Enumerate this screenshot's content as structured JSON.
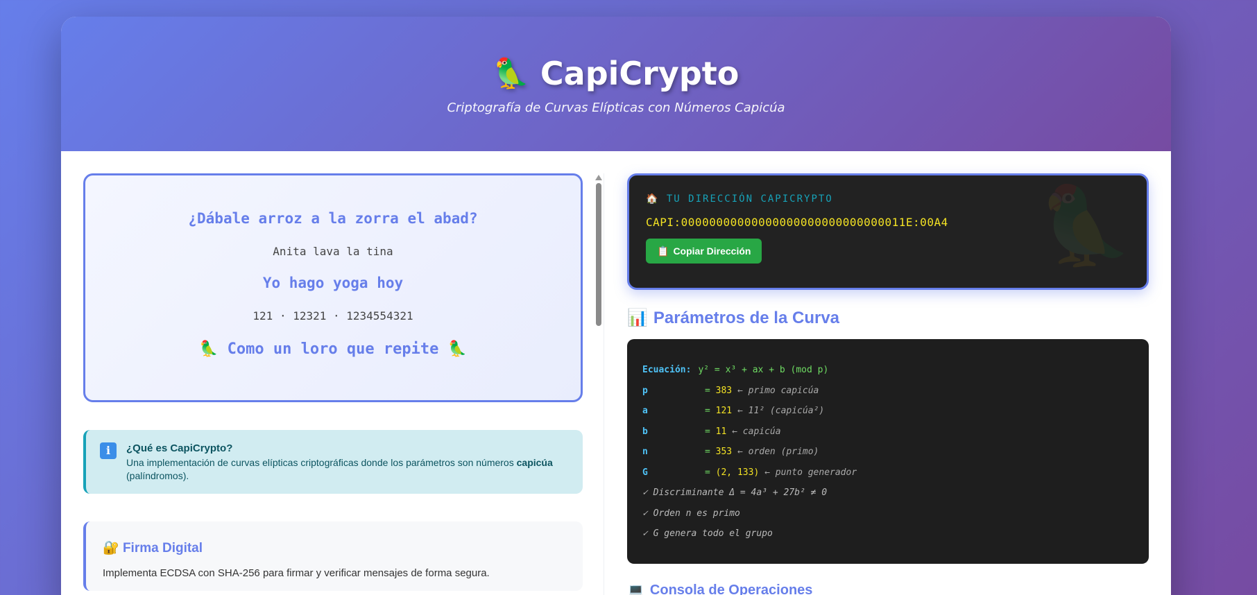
{
  "header": {
    "icon": "parrot-icon",
    "title": "CapiCrypto",
    "subtitle": "Criptografía de Curvas Elípticas con Números Capicúa"
  },
  "palindromes": {
    "line1": "¿Dábale arroz a la zorra el abad?",
    "line2": "Anita lava la tina",
    "line3": "Yo hago yoga hoy",
    "line4": "121 · 12321 · 1234554321",
    "line5": "Como un loro que repite"
  },
  "info": {
    "title": "¿Qué es CapiCrypto?",
    "text_pre": "Una implementación de curvas elípticas criptográficas donde los parámetros son números ",
    "text_bold": "capicúa",
    "text_post": " (palíndromos)."
  },
  "feature_card": {
    "icon": "lock-icon",
    "title": "Firma Digital",
    "text": "Implementa ECDSA con SHA-256 para firmar y verificar mensajes de forma segura."
  },
  "address": {
    "icon": "house-icon",
    "label": "TU DIRECCIÓN CAPICRYPTO",
    "value": "CAPI:00000000000000000000000000000011E:00A4",
    "copy_button": "Copiar Dirección",
    "copy_icon": "clipboard-icon"
  },
  "curve": {
    "section_icon": "chart-icon",
    "section_title": "Parámetros de la Curva",
    "equation_label": "Ecuación:",
    "equation": "y² = x³ + ax + b (mod p)",
    "params": [
      {
        "key": "p",
        "value": "383",
        "comment": "← primo capicúa"
      },
      {
        "key": "a",
        "value": "121",
        "comment": "← 11² (capicúa²)"
      },
      {
        "key": "b",
        "value": "11",
        "comment": "← capicúa"
      },
      {
        "key": "n",
        "value": "353",
        "comment": "← orden (primo)"
      },
      {
        "key": "G",
        "value": "(2, 133)",
        "comment": "← punto generador"
      }
    ],
    "checks": [
      "✓ Discriminante Δ = 4a³ + 27b² ≠ 0",
      "✓ Orden n es primo",
      "✓ G genera todo el grupo"
    ]
  },
  "console": {
    "icon": "monitor-icon",
    "title": "Consola de Operaciones"
  }
}
